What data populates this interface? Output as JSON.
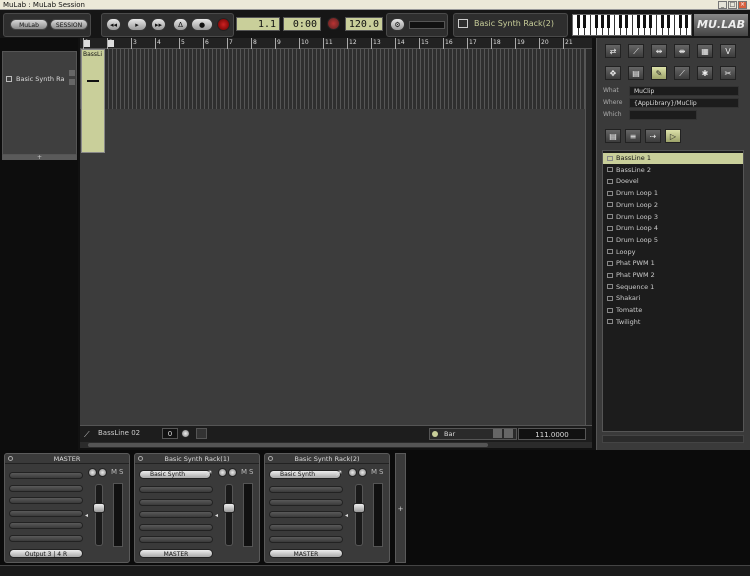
{
  "window": {
    "title": "MuLab : MuLab Session"
  },
  "toolbar": {
    "mulab_label": "MuLab",
    "session_label": "SESSION",
    "bar_position": "1.1",
    "time_position": "0:00",
    "tempo": "120.0",
    "rack_name": "Basic Synth Rack(2)",
    "logo": "MU.LAB"
  },
  "track": {
    "name": "Basic Synth Ra",
    "add_label": "+"
  },
  "ruler": {
    "ticks": [
      "1",
      "2",
      "3",
      "4",
      "5",
      "6",
      "7",
      "8",
      "9",
      "10",
      "11",
      "12",
      "13",
      "14",
      "15",
      "16",
      "17",
      "18",
      "19",
      "20",
      "21"
    ]
  },
  "clip": {
    "name": "BassLi"
  },
  "editbar": {
    "clip_name": "BassLine 02",
    "value": "0",
    "snap_label": "Bar",
    "position": "111.0000"
  },
  "browser": {
    "what_label": "What",
    "what_value": "MuClip",
    "where_label": "Where",
    "where_value": "{AppLibrary}/MuClip",
    "which_label": "Which",
    "which_value": "",
    "tool_icons": [
      "connect-icon",
      "draw-icon",
      "split-icon",
      "glue-icon",
      "grid-icon",
      "vst-icon",
      "move-icon",
      "list-icon",
      "pencil-icon",
      "line-icon",
      "star-icon",
      "scissors-icon"
    ],
    "items": [
      "BassLine 1",
      "BassLine 2",
      "Doevel",
      "Drum Loop 1",
      "Drum Loop 2",
      "Drum Loop 3",
      "Drum Loop 4",
      "Drum Loop 5",
      "Loopy",
      "Phat PWM 1",
      "Phat PWM 2",
      "Sequence 1",
      "Shakari",
      "Tomatte",
      "Twilight"
    ],
    "selected_index": 0
  },
  "mixer": {
    "strips": [
      {
        "name": "MASTER",
        "instrument": "",
        "output": "Output 3 | 4 R",
        "fader_level": 0.7
      },
      {
        "name": "Basic Synth Rack(1)",
        "instrument": "Basic Synth",
        "output": "MASTER",
        "fader_level": 0.7
      },
      {
        "name": "Basic Synth Rack(2)",
        "instrument": "Basic Synth",
        "output": "MASTER",
        "fader_level": 0.7
      }
    ],
    "add_label": "+",
    "mute_label": "M",
    "solo_label": "S"
  }
}
